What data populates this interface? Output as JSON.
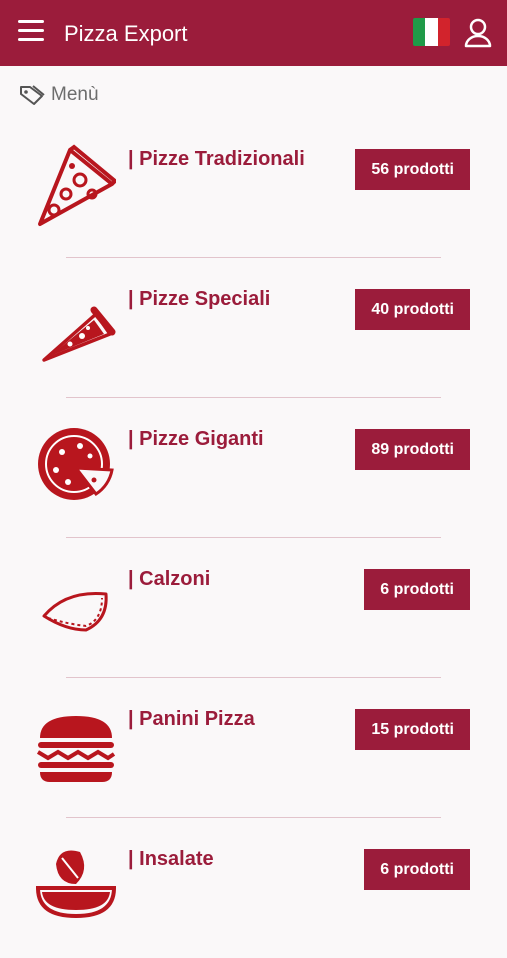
{
  "appbar": {
    "title": "Pizza Export",
    "color": "#9b1c3b"
  },
  "breadcrumb": {
    "label": "Menù"
  },
  "categories": [
    {
      "name": "| Pizze Tradizionali",
      "count": "56 prodotti",
      "icon": "pizza-slice-icon"
    },
    {
      "name": "| Pizze Speciali",
      "count": "40 prodotti",
      "icon": "pizza-wedge-icon"
    },
    {
      "name": "| Pizze Giganti",
      "count": "89 prodotti",
      "icon": "whole-pizza-icon"
    },
    {
      "name": "| Calzoni",
      "count": "6 prodotti",
      "icon": "calzone-icon"
    },
    {
      "name": "| Panini Pizza",
      "count": "15 prodotti",
      "icon": "burger-icon"
    },
    {
      "name": "| Insalate",
      "count": "6 prodotti",
      "icon": "salad-bowl-icon"
    }
  ]
}
